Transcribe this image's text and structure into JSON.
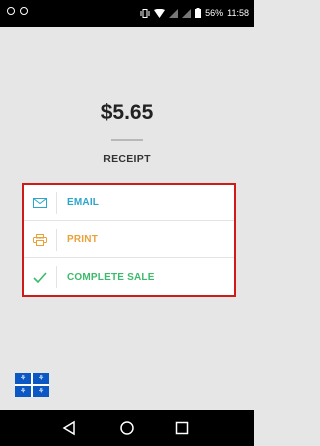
{
  "status_bar": {
    "battery": "56%",
    "time": "11:58"
  },
  "receipt": {
    "amount": "$5.65",
    "title": "RECEIPT"
  },
  "options": [
    {
      "label": "EMAIL",
      "icon": "envelope-icon",
      "color": "#2aa6c9"
    },
    {
      "label": "PRINT",
      "icon": "printer-icon",
      "color": "#e8a23a"
    },
    {
      "label": "COMPLETE SALE",
      "icon": "checkmark-icon",
      "color": "#3dba6b"
    }
  ],
  "nav_bar": {
    "buttons": [
      "back-icon",
      "home-icon",
      "recents-icon"
    ]
  },
  "colors": {
    "highlight_border": "#d01a1a",
    "flag_blue": "#0b57c4",
    "background": "#e6e6e6"
  }
}
